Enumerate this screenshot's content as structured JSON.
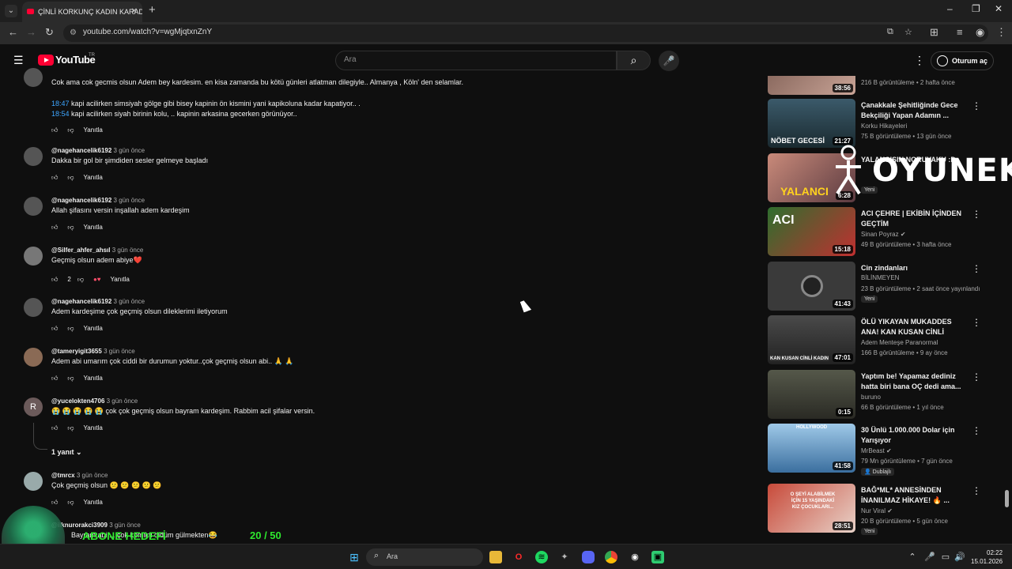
{
  "browser": {
    "tab_title": "ÇİNLİ KORKUNÇ KADIN KARAD",
    "url": "youtube.com/watch?v=wgMjqtxnZnY",
    "nav_icons": [
      "back-icon",
      "forward-icon",
      "reload-icon"
    ]
  },
  "youtube": {
    "logo_text": "YouTube",
    "logo_tr": "TR",
    "search_placeholder": "Ara",
    "signin_label": "Oturum aç"
  },
  "comments": [
    {
      "author": "",
      "time": "",
      "text": "Cok ama cok gecmis olsun Adem bey kardesim. en kisa zamanda bu kötü günleri atlatman dilegiyle.. Almanya , Köln' den selamlar.",
      "ts1": "18:47",
      "line1": " kapi acilirken simsiyah gölge gibi bisey kapinin ön kismini yani kapikoluna kadar kapatiyor.. .",
      "ts2": "18:54",
      "line2": " kapi acilirken siyah birinin  kolu, .. kapinin arkasina gecerken görünüyor..",
      "reply": "Yanıtla",
      "likes": ""
    },
    {
      "author": "@nagehancelik6192",
      "time": "3 gün önce",
      "text": "Dakka bir gol bir şimdiden sesler gelmeye başladı",
      "reply": "Yanıtla",
      "likes": ""
    },
    {
      "author": "@nagehancelik6192",
      "time": "3 gün önce",
      "text": "Allah şifasını versin inşallah adem kardeşim",
      "reply": "Yanıtla",
      "likes": ""
    },
    {
      "author": "@Silfer_ahfer_ahsıl",
      "time": "3 gün önce",
      "text": "Geçmiş olsun adem abiye❤️",
      "reply": "Yanıtla",
      "likes": "2"
    },
    {
      "author": "@nagehancelik6192",
      "time": "3 gün önce",
      "text": "Adem kardeşime çok geçmiş olsun dileklerimi iletiyorum",
      "reply": "Yanıtla",
      "likes": ""
    },
    {
      "author": "@tameryigit3655",
      "time": "3 gün önce",
      "text": "Adem abi umarım çok ciddi bir durumun yoktur..çok geçmiş olsun abi.. 🙏 🙏",
      "reply": "Yanıtla",
      "likes": ""
    },
    {
      "author": "@yucelokten4706",
      "time": "3 gün önce",
      "text": "😭 😭 😭 😭 😭  çok çok geçmiş olsun bayram kardeşim. Rabbim acil şifalar versin.",
      "reply": "Yanıtla",
      "likes": "",
      "avatar_letter": "R"
    },
    {
      "author": "@tmrcx",
      "time": "3 gün önce",
      "text": "Çok geçmiş olsun 😕 😕 😕 😕 😕",
      "reply": "Yanıtla",
      "likes": ""
    },
    {
      "author": "@ilknurorakci3909",
      "time": "3 gün önce",
      "text": "Bayram abi ... çok komikti öldüm gülmekten😂",
      "reply": "",
      "likes": ""
    }
  ],
  "replies_toggle": "1 yanıt",
  "recommendations": [
    {
      "title": "",
      "channel": "",
      "stats": "216 B görüntüleme • 2 hafta önce",
      "duration": "38:56",
      "badge": ""
    },
    {
      "title": "Çanakkale Şehitliğinde Gece Bekçiliği Yapan Adamın ...",
      "channel": "Korku Hikayeleri",
      "stats": "75 B görüntüleme • 13 gün önce",
      "duration": "21:27",
      "badge": "",
      "thumb_text": "NÖBET GECESİ"
    },
    {
      "title": "YALANCISIN NORUYAKU :D",
      "channel": "",
      "stats": "",
      "duration": "6:28",
      "badge": "Yeni",
      "thumb_text": "YALANCI"
    },
    {
      "title": "ACI ÇEHRE | EKİBİN İÇİNDEN GEÇTİM",
      "channel": "Sinan Poyraz",
      "stats": "49 B görüntüleme • 3 hafta önce",
      "duration": "15:18",
      "badge": "",
      "thumb_text": "ACI"
    },
    {
      "title": "Cin zindanları",
      "channel": "BİLİNMEYEN",
      "stats": "23 B görüntüleme • 2 saat önce yayınlandı",
      "duration": "41:43",
      "badge": "Yeni"
    },
    {
      "title": "ÖLÜ YIKAYAN MUKADDES ANA! KAN KUSAN CİNLİ KADIN - ...",
      "channel": "Adem Menteşe Paranormal",
      "stats": "166 B görüntüleme • 9 ay önce",
      "duration": "47:01",
      "badge": "",
      "thumb_text": "KAN KUSAN CİNLİ KADIN"
    },
    {
      "title": "Yaptım be! Yapamaz dediniz hatta biri bana OÇ dedi ama...",
      "channel": "buruno",
      "stats": "66 B görüntüleme • 1 yıl önce",
      "duration": "0:15",
      "badge": ""
    },
    {
      "title": "30 Ünlü 1.000.000 Dolar için Yarışıyor",
      "channel": "MrBeast",
      "stats": "79 Mn görüntüleme • 7 gün önce",
      "duration": "41:58",
      "badge": "Dublajlı",
      "thumb_text": "HOLLYWOOD"
    },
    {
      "title": "BAĞ*ML* ANNESİNDEN İNANILMAZ HİKAYE! 🔥 ...",
      "channel": "Nur Viral",
      "stats": "20 B görüntüleme • 5 gün önce",
      "duration": "28:51",
      "badge": "Yeni",
      "thumb_text": "O ŞEYİ ALABİLMEK İÇİN 15 YAŞINDAKİ KIZ ÇOCUKLARI..."
    }
  ],
  "overlay": {
    "oyuneks": "OYUNEKS",
    "goal_label": "ABONE HEDEFİ",
    "goal_count": "20 / 50",
    "goal_progress": 0.4
  },
  "taskbar": {
    "search_label": "Ara",
    "time": "02:22",
    "date": "15.01.2026"
  },
  "colors": {
    "background": "#0f0f0f",
    "timestamp_link": "#3ea6ff",
    "brand_red": "#ff0033",
    "goal_green": "#2ee82e"
  }
}
